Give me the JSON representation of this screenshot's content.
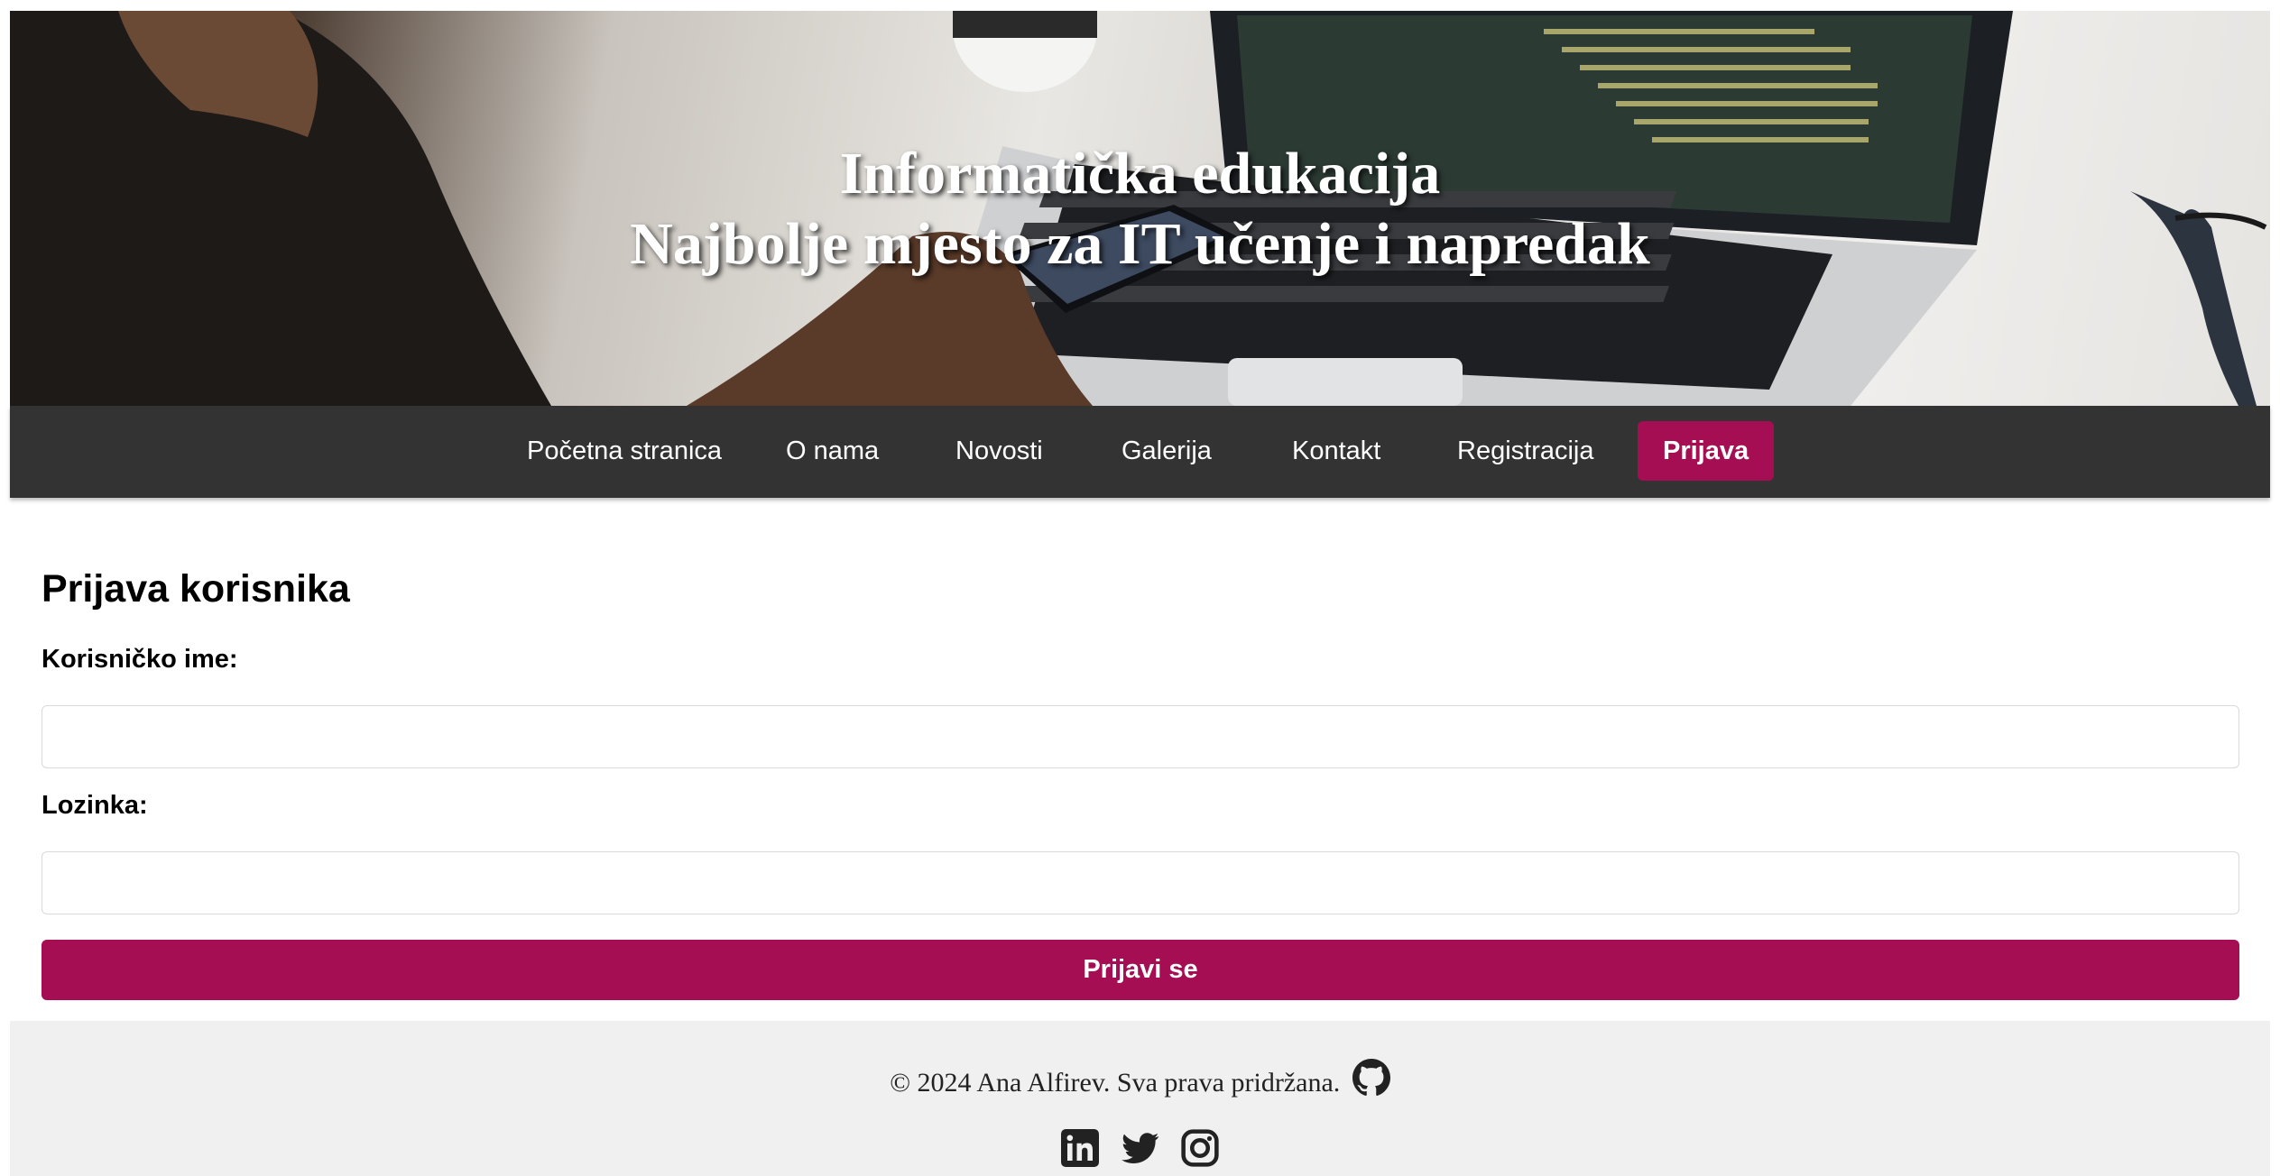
{
  "hero": {
    "title_line1": "Informatička edukacija",
    "title_line2": "Najbolje mjesto za IT učenje i napredak"
  },
  "nav": {
    "items": [
      {
        "label": "Početna stranica",
        "active": false
      },
      {
        "label": "O nama",
        "active": false
      },
      {
        "label": "Novosti",
        "active": false
      },
      {
        "label": "Galerija",
        "active": false
      },
      {
        "label": "Kontakt",
        "active": false
      },
      {
        "label": "Registracija",
        "active": false
      },
      {
        "label": "Prijava",
        "active": true
      }
    ]
  },
  "form": {
    "title": "Prijava korisnika",
    "username_label": "Korisničko ime:",
    "username_value": "",
    "password_label": "Lozinka:",
    "password_value": "",
    "submit_label": "Prijavi se"
  },
  "footer": {
    "copyright": "© 2024 Ana Alfirev. Sva prava pridržana.",
    "icons": [
      "github-icon",
      "linkedin-icon",
      "twitter-icon",
      "instagram-icon"
    ]
  },
  "colors": {
    "accent": "#a50e52",
    "nav_bg": "#333333",
    "footer_bg": "#f0f0f0"
  }
}
